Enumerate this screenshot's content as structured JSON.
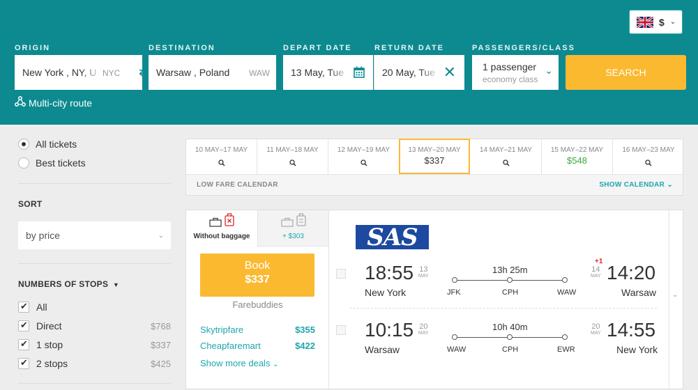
{
  "header": {
    "currency": "$",
    "labels": {
      "origin": "ORIGIN",
      "destination": "DESTINATION",
      "depart": "DEPART DATE",
      "return": "RETURN DATE",
      "passengers": "PASSENGERS/CLASS"
    },
    "origin": {
      "value": "New York , NY, U",
      "code": "NYC"
    },
    "destination": {
      "value": "Warsaw , Poland",
      "code": "WAW"
    },
    "depart_value": "13 May, Tue",
    "return_value": "20 May, Tue",
    "passengers": {
      "count": "1 passenger",
      "class": "economy class"
    },
    "search_label": "SEARCH",
    "multicity_label": "Multi-city route"
  },
  "sidebar": {
    "ticket_options": [
      "All tickets",
      "Best tickets"
    ],
    "sort_title": "SORT",
    "sort_value": "by price",
    "stops_title": "NUMBERS OF STOPS",
    "stops": [
      {
        "label": "All",
        "price": ""
      },
      {
        "label": "Direct",
        "price": "$768"
      },
      {
        "label": "1 stop",
        "price": "$337"
      },
      {
        "label": "2 stops",
        "price": "$425"
      }
    ]
  },
  "calendar": {
    "cells": [
      {
        "dates": "10 MAY–17 MAY",
        "price": ""
      },
      {
        "dates": "11 MAY–18 MAY",
        "price": ""
      },
      {
        "dates": "12 MAY–19 MAY",
        "price": ""
      },
      {
        "dates": "13 MAY–20 MAY",
        "price": "$337"
      },
      {
        "dates": "14 MAY–21 MAY",
        "price": ""
      },
      {
        "dates": "15 MAY–22 MAY",
        "price": "$548"
      },
      {
        "dates": "16 MAY–23 MAY",
        "price": ""
      }
    ],
    "low_fare_label": "LOW FARE CALENDAR",
    "show_calendar_label": "SHOW CALENDAR"
  },
  "ticket": {
    "tab_without": "Without baggage",
    "tab_with_price": "+ $303",
    "book_label": "Book",
    "book_price": "$337",
    "seller": "Farebuddies",
    "deals": [
      {
        "name": "Skytripfare",
        "price": "$355"
      },
      {
        "name": "Cheapfaremart",
        "price": "$422"
      }
    ],
    "more_deals": "Show more deals",
    "airline": "SAS",
    "outbound": {
      "dep_time": "18:55",
      "dep_day": "13",
      "dep_month": "MAY",
      "dep_city": "New York",
      "duration": "13h 25m",
      "stops": [
        "JFK",
        "CPH",
        "WAW"
      ],
      "arr_time": "14:20",
      "arr_day": "14",
      "arr_month": "MAY",
      "arr_city": "Warsaw",
      "plus_day": "+1"
    },
    "inbound": {
      "dep_time": "10:15",
      "dep_day": "20",
      "dep_month": "MAY",
      "dep_city": "Warsaw",
      "duration": "10h 40m",
      "stops": [
        "WAW",
        "CPH",
        "EWR"
      ],
      "arr_time": "14:55",
      "arr_day": "20",
      "arr_month": "MAY",
      "arr_city": "New York"
    }
  }
}
